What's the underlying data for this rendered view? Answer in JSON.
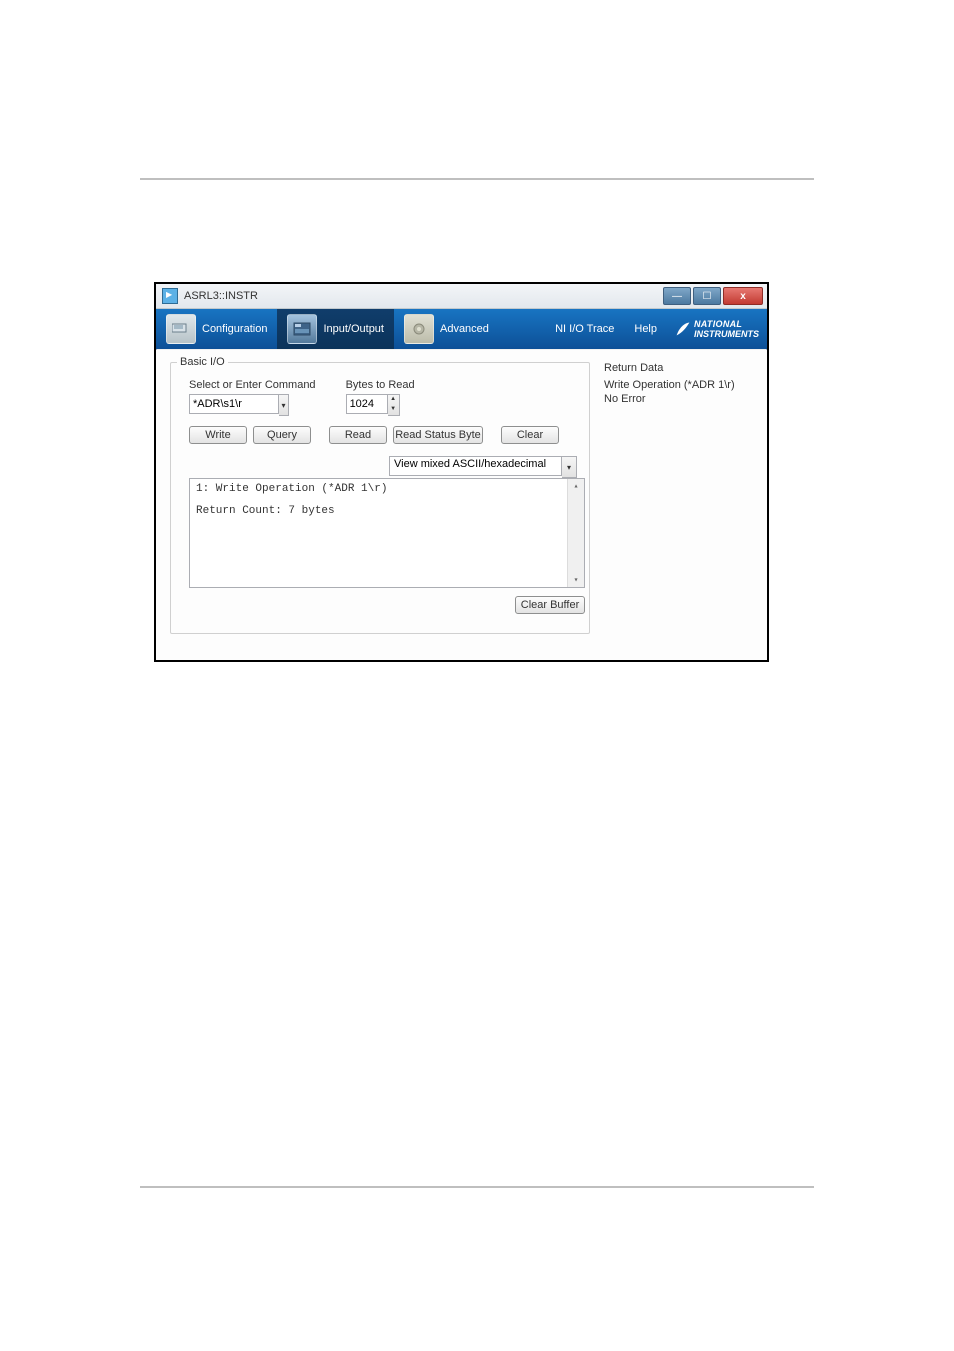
{
  "window": {
    "title": "ASRL3::INSTR"
  },
  "toolbar": {
    "configuration": "Configuration",
    "input_output": "Input/Output",
    "advanced": "Advanced",
    "ni_trace": "NI I/O Trace",
    "help": "Help",
    "logo_line1": "NATIONAL",
    "logo_line2": "INSTRUMENTS"
  },
  "basic_io": {
    "legend": "Basic I/O",
    "command_label": "Select or Enter Command",
    "command_value": "*ADR\\s1\\r",
    "bytes_label": "Bytes to Read",
    "bytes_value": "1024",
    "write_btn": "Write",
    "query_btn": "Query",
    "read_btn": "Read",
    "read_status_btn": "Read Status Byte",
    "clear_btn": "Clear",
    "view_mode": "View mixed ASCII/hexadecimal",
    "log_line1": "1: Write Operation (*ADR 1\\r)",
    "log_line2": "Return Count: 7 bytes",
    "clear_buffer_btn": "Clear Buffer"
  },
  "return_data": {
    "title": "Return Data",
    "line1": "Write Operation (*ADR 1\\r)",
    "line2": "No Error"
  }
}
